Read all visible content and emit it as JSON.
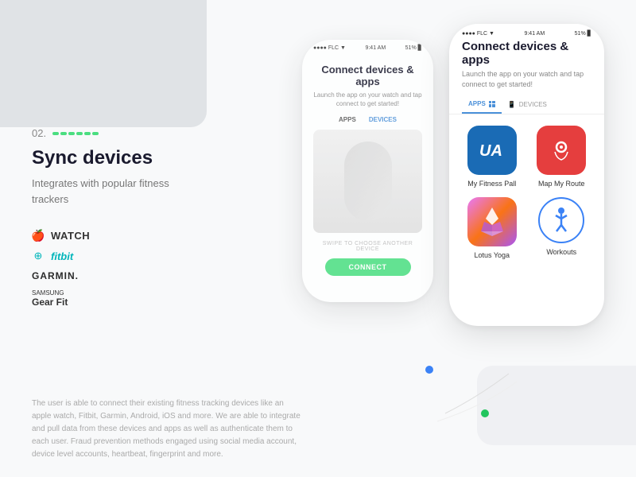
{
  "page": {
    "step_number": "02.",
    "step_dots_count": 6,
    "section_title": "Sync devices",
    "section_desc": "Integrates with popular fitness trackers",
    "brands": [
      {
        "name": "APPLE WATCH",
        "type": "apple"
      },
      {
        "name": "fitbit",
        "type": "fitbit"
      },
      {
        "name": "GARMIN.",
        "type": "garmin"
      },
      {
        "name": "Gear Fit",
        "type": "samsung",
        "prefix": "SAMSUNG"
      }
    ],
    "footer_text": "The user is able to connect their existing fitness tracking devices like an apple watch, Fitbit, Garmin, Android, iOS and more. We are able to integrate and pull data from these devices and apps as well as authenticate them to each user. Fraud prevention methods engaged using social media account, device level accounts, heartbeat, fingerprint and more."
  },
  "phone_left": {
    "status_left": "●●●● FLC ▼",
    "status_center": "9:41 AM",
    "status_right": "51% ▊",
    "title": "Connect devices & apps",
    "subtitle": "Launch the app on your watch and tap connect to get started!",
    "tab_apps": "APPS",
    "tab_devices": "DEVICES",
    "swipe_text": "SWIPE TO CHOOSE ANOTHER DEVICE",
    "connect_btn": "CONNECT"
  },
  "phone_right": {
    "status_left": "●●●● FLC ▼",
    "status_center": "9:41 AM",
    "status_right": "51% ▊",
    "title": "Connect devices & apps",
    "subtitle": "Launch the app on your watch and tap connect to get started!",
    "tab_apps": "APPS",
    "tab_devices": "DEVICES",
    "apps": [
      {
        "name": "My Fitness Pall",
        "type": "ua"
      },
      {
        "name": "Map My Route",
        "type": "map"
      },
      {
        "name": "Lotus Yoga",
        "type": "yoga"
      },
      {
        "name": "Workouts",
        "type": "workout"
      }
    ]
  },
  "colors": {
    "accent_green": "#4ade80",
    "accent_blue": "#3b82f6",
    "title": "#1a1a2e",
    "subtitle": "#777"
  }
}
